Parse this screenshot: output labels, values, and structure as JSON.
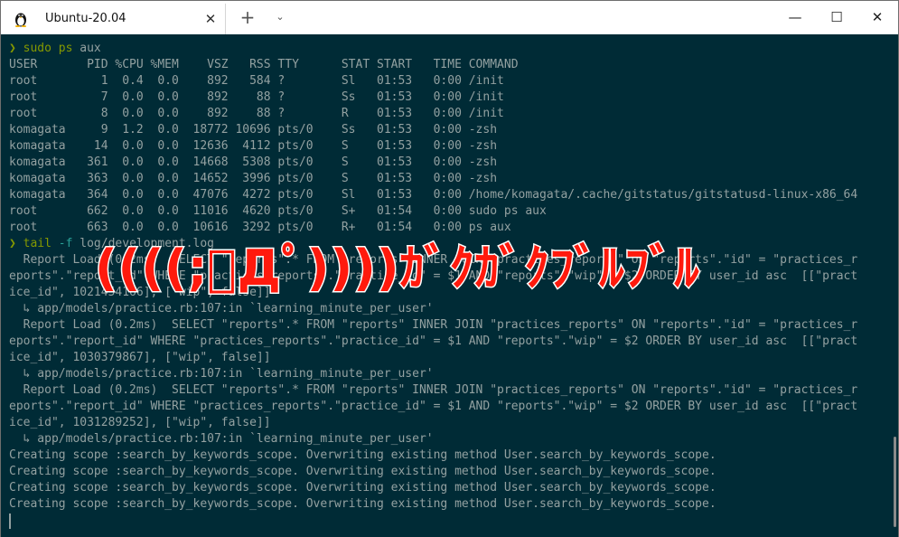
{
  "titlebar": {
    "tab_title": "Ubuntu-20.04",
    "tab_icon": "linux-penguin-icon",
    "close_tab_glyph": "✕",
    "new_tab_glyph": "+",
    "dropdown_glyph": "⌄",
    "minimize_glyph": "—",
    "maximize_glyph": "☐",
    "close_glyph": "✕"
  },
  "colors": {
    "terminal_bg": "#002b36",
    "terminal_fg": "#93a1a1",
    "prompt_green": "#859900",
    "flag_cyan": "#2aa198",
    "overlay_red": "#ff1a0d"
  },
  "terminal": {
    "prompt_glyph": "❯",
    "cmd1": {
      "name": "sudo ps",
      "args": " aux"
    },
    "ps_lines": [
      "USER       PID %CPU %MEM    VSZ   RSS TTY      STAT START   TIME COMMAND",
      "root         1  0.4  0.0    892   584 ?        Sl   01:53   0:00 /init",
      "root         7  0.0  0.0    892    88 ?        Ss   01:53   0:00 /init",
      "root         8  0.0  0.0    892    88 ?        R    01:53   0:00 /init",
      "komagata     9  1.2  0.0  18772 10696 pts/0    Ss   01:53   0:00 -zsh",
      "komagata    14  0.0  0.0  12636  4112 pts/0    S    01:53   0:00 -zsh",
      "komagata   361  0.0  0.0  14668  5308 pts/0    S    01:53   0:00 -zsh",
      "komagata   363  0.0  0.0  14652  3996 pts/0    S    01:53   0:00 -zsh",
      "komagata   364  0.0  0.0  47076  4272 pts/0    Sl   01:53   0:00 /home/komagata/.cache/gitstatus/gitstatusd-linux-x86_64",
      "root       662  0.0  0.0  11016  4620 pts/0    S+   01:54   0:00 sudo ps aux",
      "root       663  0.0  0.0  10616  3292 pts/0    R+   01:54   0:00 ps aux"
    ],
    "cmd2": {
      "name": "tail",
      "flag": " -f",
      "args": " log/development.log"
    },
    "log_lines": [
      "  Report Load (0.2ms)  SELECT \"reports\".* FROM \"reports\" INNER JOIN \"practices_reports\" ON \"reports\".\"id\" = \"practices_r",
      "eports\".\"report_id\" WHERE \"practices_reports\".\"practice_id\" = $1 AND \"reports\".\"wip\" = $2 ORDER BY user_id asc  [[\"pract",
      "ice_id\", 1021454166], [\"wip\", false]]",
      "  ↳ app/models/practice.rb:107:in `learning_minute_per_user'",
      "  Report Load (0.2ms)  SELECT \"reports\".* FROM \"reports\" INNER JOIN \"practices_reports\" ON \"reports\".\"id\" = \"practices_r",
      "eports\".\"report_id\" WHERE \"practices_reports\".\"practice_id\" = $1 AND \"reports\".\"wip\" = $2 ORDER BY user_id asc  [[\"pract",
      "ice_id\", 1030379867], [\"wip\", false]]",
      "  ↳ app/models/practice.rb:107:in `learning_minute_per_user'",
      "  Report Load (0.2ms)  SELECT \"reports\".* FROM \"reports\" INNER JOIN \"practices_reports\" ON \"reports\".\"id\" = \"practices_r",
      "eports\".\"report_id\" WHERE \"practices_reports\".\"practice_id\" = $1 AND \"reports\".\"wip\" = $2 ORDER BY user_id asc  [[\"pract",
      "ice_id\", 1031289252], [\"wip\", false]]",
      "  ↳ app/models/practice.rb:107:in `learning_minute_per_user'",
      "Creating scope :search_by_keywords_scope. Overwriting existing method User.search_by_keywords_scope.",
      "Creating scope :search_by_keywords_scope. Overwriting existing method User.search_by_keywords_scope.",
      "Creating scope :search_by_keywords_scope. Overwriting existing method User.search_by_keywords_scope.",
      "Creating scope :search_by_keywords_scope. Overwriting existing method User.search_by_keywords_scope."
    ]
  },
  "overlay": {
    "text": "((((;ﾟДﾟ))))ｶﾞｸｶﾞｸﾌﾞﾙﾌﾞﾙ"
  }
}
